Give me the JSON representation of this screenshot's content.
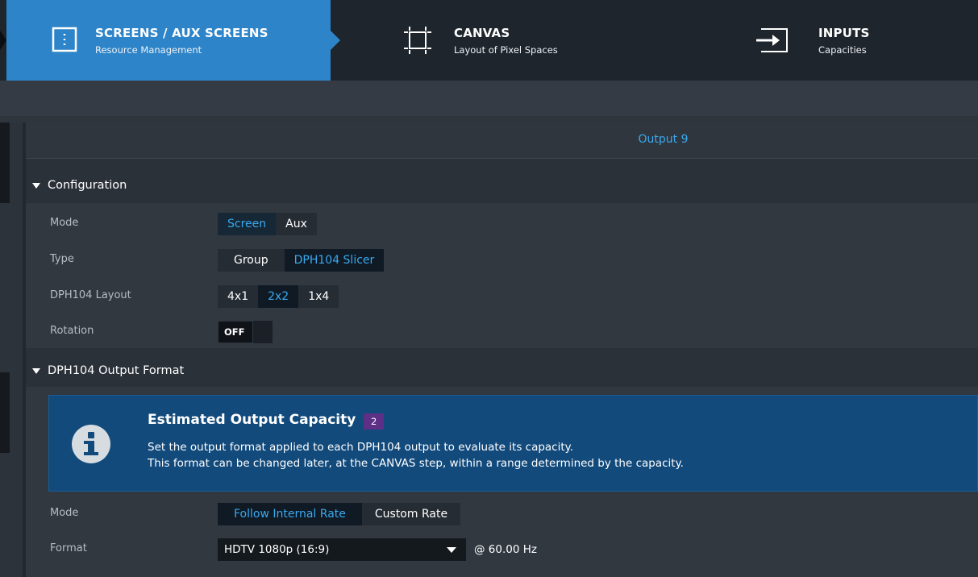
{
  "steps": [
    {
      "title": "SCREENS / AUX SCREENS",
      "subtitle": "Resource Management",
      "icon": "screens-icon",
      "active": true
    },
    {
      "title": "CANVAS",
      "subtitle": "Layout of Pixel Spaces",
      "icon": "canvas-crop-icon",
      "active": false
    },
    {
      "title": "INPUTS",
      "subtitle": "Capacities",
      "icon": "input-arrow-icon",
      "active": false
    }
  ],
  "output_title": "Output 9",
  "configuration": {
    "label": "Configuration",
    "mode": {
      "label": "Mode",
      "options": [
        "Screen",
        "Aux"
      ],
      "selected": "Screen"
    },
    "type": {
      "label": "Type",
      "options": [
        "Group",
        "DPH104 Slicer"
      ],
      "selected": "DPH104 Slicer"
    },
    "layout": {
      "label": "DPH104 Layout",
      "options": [
        "4x1",
        "2x2",
        "1x4"
      ],
      "selected": "2x2"
    },
    "rotation": {
      "label": "Rotation",
      "value": "OFF"
    }
  },
  "output_format": {
    "label": "DPH104 Output Format",
    "info": {
      "title": "Estimated Output Capacity",
      "badge": "2",
      "line1": "Set the output format applied to each DPH104 output to evaluate its capacity.",
      "line2": "This format can be changed later, at the CANVAS step, within a range determined by the capacity."
    },
    "mode": {
      "label": "Mode",
      "options": [
        "Follow Internal Rate",
        "Custom Rate"
      ],
      "selected": "Follow Internal Rate"
    },
    "format": {
      "label": "Format",
      "value": "HDTV 1080p (16:9)",
      "rate": "@ 60.00 Hz"
    }
  },
  "colors": {
    "accent": "#3ba9ee",
    "active_step": "#2d84c8",
    "info_bg": "#124a7c",
    "badge": "#5d2f86"
  }
}
